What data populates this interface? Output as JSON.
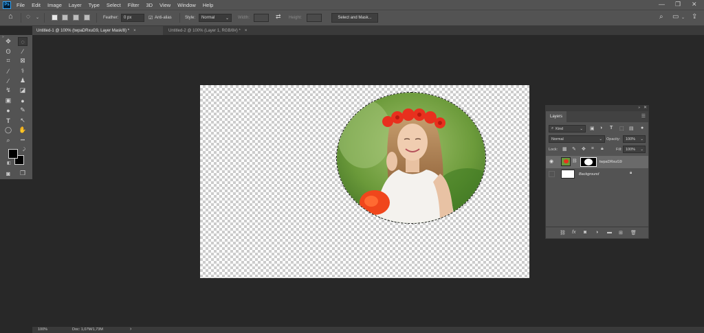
{
  "app": {
    "logo": "Ps"
  },
  "menu": [
    "File",
    "Edit",
    "Image",
    "Layer",
    "Type",
    "Select",
    "Filter",
    "3D",
    "View",
    "Window",
    "Help"
  ],
  "window_controls": {
    "minimize": "—",
    "maximize": "❐",
    "close": "✕"
  },
  "options": {
    "feather_label": "Feather:",
    "feather_value": "0 px",
    "antialias_label": "Anti-alias",
    "style_label": "Style:",
    "style_value": "Normal",
    "width_label": "Width:",
    "height_label": "Height:",
    "select_mask_label": "Select and Mask..."
  },
  "tabs": [
    {
      "label": "Untitled-1 @ 100% (twpaDRxuG9, Layer Mask/8) *",
      "close": "×"
    },
    {
      "label": "Untitled-2 @ 100% (Layer 1, RGB/8#) *",
      "close": "×"
    }
  ],
  "tools": [
    {
      "name": "move",
      "glyph": "✥"
    },
    {
      "name": "marquee",
      "glyph": "◌"
    },
    {
      "name": "lasso",
      "glyph": "ʘ"
    },
    {
      "name": "quick-select",
      "glyph": "⁄"
    },
    {
      "name": "crop",
      "glyph": "⌗"
    },
    {
      "name": "frame",
      "glyph": "⊠"
    },
    {
      "name": "eyedropper",
      "glyph": "⁄"
    },
    {
      "name": "healing",
      "glyph": "⚕"
    },
    {
      "name": "brush",
      "glyph": "∕"
    },
    {
      "name": "stamp",
      "glyph": "♟"
    },
    {
      "name": "history-brush",
      "glyph": "↯"
    },
    {
      "name": "eraser",
      "glyph": "◪"
    },
    {
      "name": "gradient",
      "glyph": "▣"
    },
    {
      "name": "blur",
      "glyph": "●"
    },
    {
      "name": "dodge",
      "glyph": "●"
    },
    {
      "name": "pen",
      "glyph": "✎"
    },
    {
      "name": "type",
      "glyph": "T"
    },
    {
      "name": "path-select",
      "glyph": "↖"
    },
    {
      "name": "ellipse",
      "glyph": "◯"
    },
    {
      "name": "hand",
      "glyph": "✋"
    },
    {
      "name": "zoom",
      "glyph": "⌕"
    },
    {
      "name": "more",
      "glyph": "•••"
    },
    {
      "name": "quick-mask",
      "glyph": "◙"
    },
    {
      "name": "screen-mode",
      "glyph": "❒"
    }
  ],
  "colors": {
    "foreground": "#000000",
    "background": "#000000",
    "accent": "#31a8ff"
  },
  "layers_panel": {
    "title": "Layers",
    "filter_value": "Kind",
    "blend_mode": "Normal",
    "opacity_label": "Opacity:",
    "opacity_value": "100%",
    "lock_label": "Lock:",
    "fill_label": "Fill:",
    "fill_value": "100%",
    "layers": [
      {
        "name": "twpaDRxuG9",
        "visible": true,
        "selected": true,
        "has_mask": true
      },
      {
        "name": "Background",
        "visible": false,
        "selected": false,
        "locked": true
      }
    ]
  },
  "status": {
    "zoom": "100%",
    "doc": "Doc: 1,07M/1,73M",
    "arrow": "›"
  }
}
